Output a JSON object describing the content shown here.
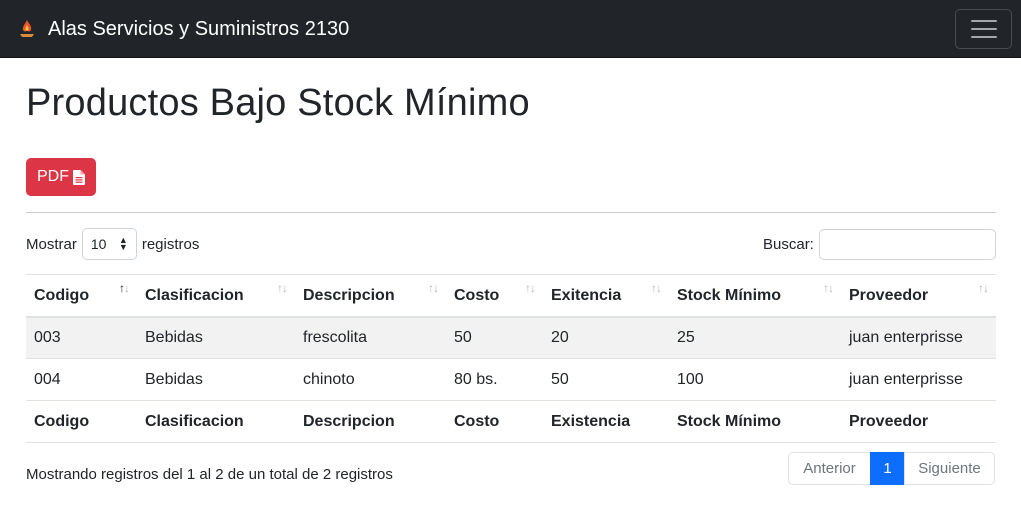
{
  "navbar": {
    "brand": "Alas Servicios y Suministros 2130",
    "logo_icon": "flame-icon",
    "menu_icon": "hamburger-menu-icon"
  },
  "page": {
    "title": "Productos Bajo Stock Mínimo"
  },
  "toolbar": {
    "pdf_label": "PDF",
    "pdf_icon": "file-text-icon",
    "pdf_color": "#dc3545"
  },
  "length": {
    "prefix": "Mostrar",
    "value": "10",
    "suffix": "registros"
  },
  "search": {
    "label": "Buscar:",
    "value": ""
  },
  "table": {
    "headers": [
      "Codigo",
      "Clasificacion",
      "Descripcion",
      "Costo",
      "Exitencia",
      "Stock Mínimo",
      "Proveedor"
    ],
    "rows": [
      [
        "003",
        "Bebidas",
        "frescolita",
        "50",
        "20",
        "25",
        "juan enterprisse"
      ],
      [
        "004",
        "Bebidas",
        "chinoto",
        "80 bs.",
        "50",
        "100",
        "juan enterprisse"
      ]
    ],
    "footers": [
      "Codigo",
      "Clasificacion",
      "Descripcion",
      "Costo",
      "Existencia",
      "Stock Mínimo",
      "Proveedor"
    ],
    "sorted_column": "Codigo"
  },
  "info": "Mostrando registros del 1 al 2 de un total de 2 registros",
  "pagination": {
    "prev": "Anterior",
    "current": "1",
    "next": "Siguiente",
    "accent": "#0d6efd"
  }
}
